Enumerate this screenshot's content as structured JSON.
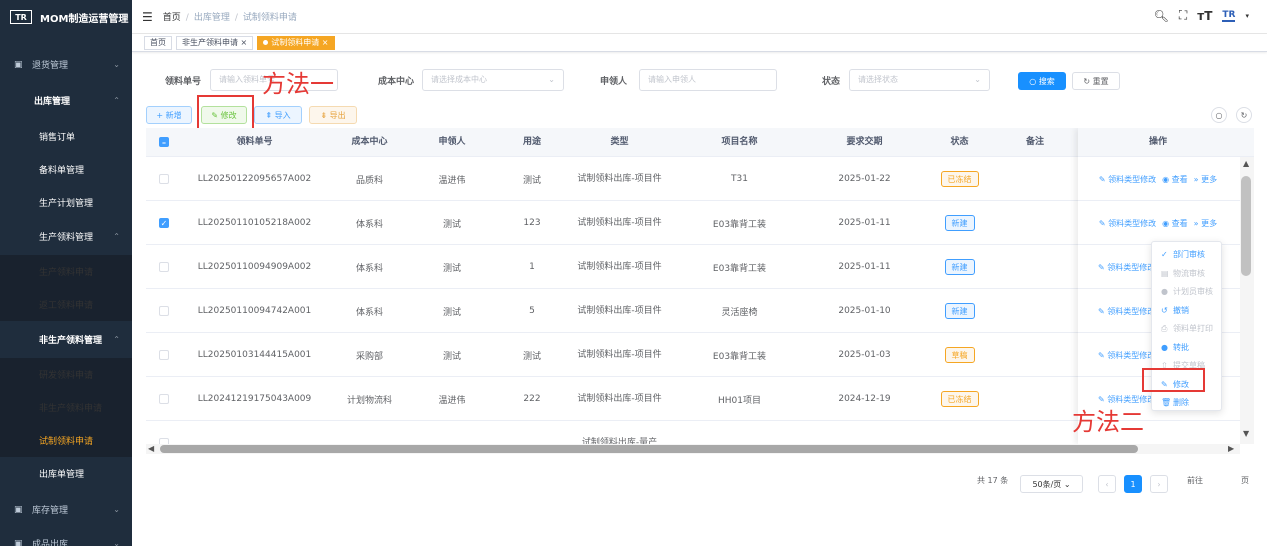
{
  "app": {
    "logo_mark": "TR",
    "title": "MOM制造运营管理"
  },
  "sidebar": {
    "items": [
      {
        "label": "退货管理",
        "level": "top",
        "icon": "return-icon"
      },
      {
        "label": "出库管理",
        "level": "open"
      },
      {
        "label": "销售订单",
        "level": "sub"
      },
      {
        "label": "备料单管理",
        "level": "sub"
      },
      {
        "label": "生产计划管理",
        "level": "sub"
      },
      {
        "label": "生产领料管理",
        "level": "sub"
      },
      {
        "label": "生产领料申请",
        "level": "sub2"
      },
      {
        "label": "返工领料申请",
        "level": "sub2"
      },
      {
        "label": "非生产领料管理",
        "level": "sub"
      },
      {
        "label": "研发领料申请",
        "level": "sub2"
      },
      {
        "label": "非生产领料申请",
        "level": "sub2"
      },
      {
        "label": "试制领料申请",
        "level": "sub2",
        "active": true
      },
      {
        "label": "出库单管理",
        "level": "sub"
      },
      {
        "label": "库存管理",
        "level": "top",
        "icon": "inventory-icon"
      },
      {
        "label": "成品出库",
        "level": "top",
        "icon": "list-icon"
      }
    ]
  },
  "breadcrumb": {
    "home": "首页",
    "level1": "出库管理",
    "level2": "试制领料申请"
  },
  "header_icons": [
    "search-icon",
    "fullscreen-icon",
    "font-size-icon",
    "brand-logo-icon"
  ],
  "tags": {
    "home": "首页",
    "tag1": "非生产领料申请",
    "tag2": "试制领料申请",
    "close": "×"
  },
  "search": {
    "f1_label": "领料单号",
    "f1_placeholder": "请输入领料单号",
    "f2_label": "成本中心",
    "f2_placeholder": "请选择成本中心",
    "f3_label": "申领人",
    "f3_placeholder": "请输入申领人",
    "f4_label": "状态",
    "f4_placeholder": "请选择状态",
    "search_btn": "搜索",
    "reset_btn": "重置"
  },
  "toolbar": {
    "add": "+ 新增",
    "edit": "修改",
    "import": "导入",
    "export": "导出"
  },
  "annotations": {
    "method1": "方法一",
    "method2": "方法二"
  },
  "table": {
    "headers": [
      "领料单号",
      "成本中心",
      "申领人",
      "用途",
      "类型",
      "项目名称",
      "要求交期",
      "状态",
      "备注",
      "操作"
    ],
    "rows": [
      {
        "no": "LL20250122095657A002",
        "center": "品质科",
        "applicant": "温进伟",
        "purpose": "测试",
        "type": "试制领料出库-项目件",
        "project": "T31",
        "date": "2025-01-22",
        "status": "已冻结",
        "status_kind": "frozen",
        "checked": false
      },
      {
        "no": "LL20250110105218A002",
        "center": "体系科",
        "applicant": "测试",
        "purpose": "123",
        "type": "试制领料出库-项目件",
        "project": "E03靠背工装",
        "date": "2025-01-11",
        "status": "新建",
        "status_kind": "new",
        "checked": true
      },
      {
        "no": "LL20250110094909A002",
        "center": "体系科",
        "applicant": "测试",
        "purpose": "1",
        "type": "试制领料出库-项目件",
        "project": "E03靠背工装",
        "date": "2025-01-11",
        "status": "新建",
        "status_kind": "new",
        "checked": false
      },
      {
        "no": "LL20250110094742A001",
        "center": "体系科",
        "applicant": "测试",
        "purpose": "5",
        "type": "试制领料出库-项目件",
        "project": "灵活座椅",
        "date": "2025-01-10",
        "status": "新建",
        "status_kind": "new",
        "checked": false
      },
      {
        "no": "LL20250103144415A001",
        "center": "采购部",
        "applicant": "测试",
        "purpose": "测试",
        "type": "试制领料出库-项目件",
        "project": "E03靠背工装",
        "date": "2025-01-03",
        "status": "草稿",
        "status_kind": "draft",
        "checked": false
      },
      {
        "no": "LL20241219175043A009",
        "center": "计划物流科",
        "applicant": "温进伟",
        "purpose": "222",
        "type": "试制领料出库-项目件",
        "project": "HH01项目",
        "date": "2024-12-19",
        "status": "已冻结",
        "status_kind": "frozen",
        "checked": false
      },
      {
        "no": "",
        "center": "",
        "applicant": "",
        "purpose": "",
        "type": "试制领料出库-量产",
        "project": "",
        "date": "",
        "status": "",
        "status_kind": "new",
        "checked": false
      }
    ],
    "ops": {
      "edit_type": "领料类型修改",
      "view": "查看",
      "more": "更多"
    }
  },
  "dropdown": [
    {
      "label": "部门审核",
      "icon": "check-icon",
      "enabled": true
    },
    {
      "label": "物流审核",
      "icon": "document-icon",
      "enabled": false
    },
    {
      "label": "计划员审核",
      "icon": "user-icon",
      "enabled": false
    },
    {
      "label": "撤销",
      "icon": "undo-icon",
      "enabled": true
    },
    {
      "label": "领料单打印",
      "icon": "print-icon",
      "enabled": false
    },
    {
      "label": "转批",
      "icon": "user-icon",
      "enabled": true
    },
    {
      "label": "提交草稿",
      "icon": "upload-icon",
      "enabled": false
    },
    {
      "label": "修改",
      "icon": "edit-icon",
      "enabled": true
    },
    {
      "label": "删除",
      "icon": "delete-icon",
      "enabled": true
    }
  ],
  "pagination": {
    "total": "共 17 条",
    "page_size": "50条/页",
    "current": "1",
    "goto": "前往",
    "page_unit": "页"
  },
  "colors": {
    "sidebar_bg": "#1f2d3d",
    "active": "#f5a623",
    "primary": "#1890ff",
    "annotation": "#e53935"
  }
}
